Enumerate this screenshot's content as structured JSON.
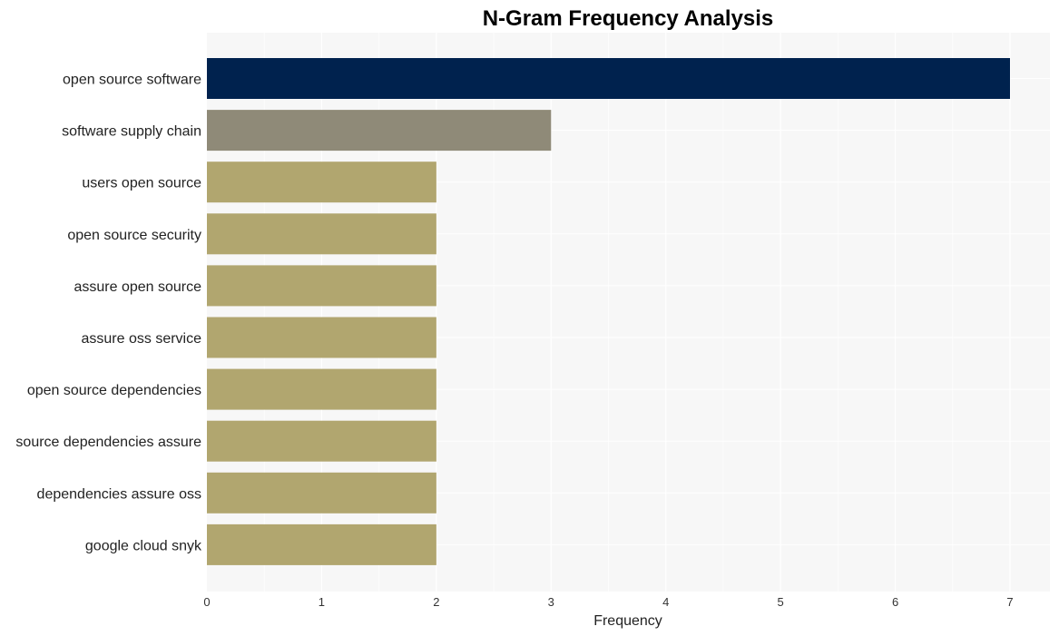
{
  "chart_data": {
    "type": "bar",
    "orientation": "horizontal",
    "title": "N-Gram Frequency Analysis",
    "xlabel": "Frequency",
    "ylabel": "",
    "xlim": [
      0,
      7.35
    ],
    "xticks": [
      0,
      1,
      2,
      3,
      4,
      5,
      6,
      7
    ],
    "grid": true,
    "categories": [
      "open source software",
      "software supply chain",
      "users open source",
      "open source security",
      "assure open source",
      "assure oss service",
      "open source dependencies",
      "source dependencies assure",
      "dependencies assure oss",
      "google cloud snyk"
    ],
    "values": [
      7,
      3,
      2,
      2,
      2,
      2,
      2,
      2,
      2,
      2
    ],
    "colors": [
      "#00224e",
      "#8f8a78",
      "#b1a66f",
      "#b1a66f",
      "#b1a66f",
      "#b1a66f",
      "#b1a66f",
      "#b1a66f",
      "#b1a66f",
      "#b1a66f"
    ],
    "background": "#f7f7f7"
  }
}
